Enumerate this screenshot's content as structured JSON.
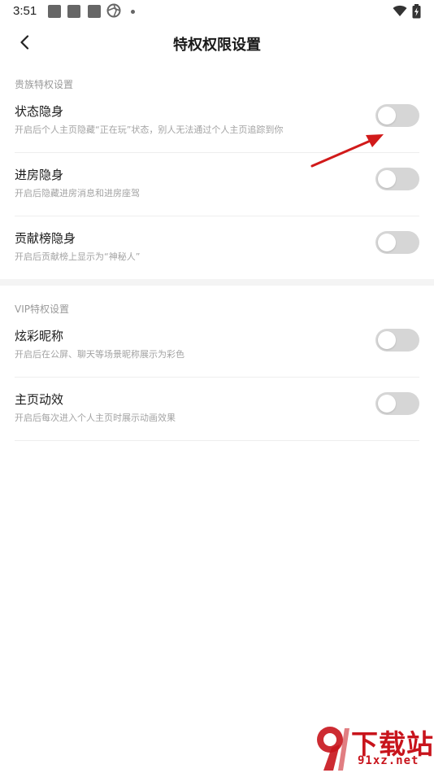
{
  "status_bar": {
    "time": "3:51"
  },
  "header": {
    "title": "特权权限设置"
  },
  "sections": [
    {
      "label": "贵族特权设置",
      "items": [
        {
          "title": "状态隐身",
          "desc": "开启后个人主页隐藏“正在玩”状态，别人无法通过个人主页追踪到你",
          "enabled": false
        },
        {
          "title": "进房隐身",
          "desc": "开启后隐藏进房消息和进房座驾",
          "enabled": false
        },
        {
          "title": "贡献榜隐身",
          "desc": "开启后贡献榜上显示为“神秘人”",
          "enabled": false
        }
      ]
    },
    {
      "label": "VIP特权设置",
      "items": [
        {
          "title": "炫彩昵称",
          "desc": "开启后在公屏、聊天等场景昵称展示为彩色",
          "enabled": false
        },
        {
          "title": "主页动效",
          "desc": "开启后每次进入个人主页时展示动画效果",
          "enabled": false
        }
      ]
    }
  ],
  "watermark": {
    "brand": "下载站",
    "url": "91xz.net"
  },
  "colors": {
    "toggle_off": "#d6d6d6",
    "annotation_arrow": "#d11a1a",
    "watermark": "#c8141c"
  }
}
